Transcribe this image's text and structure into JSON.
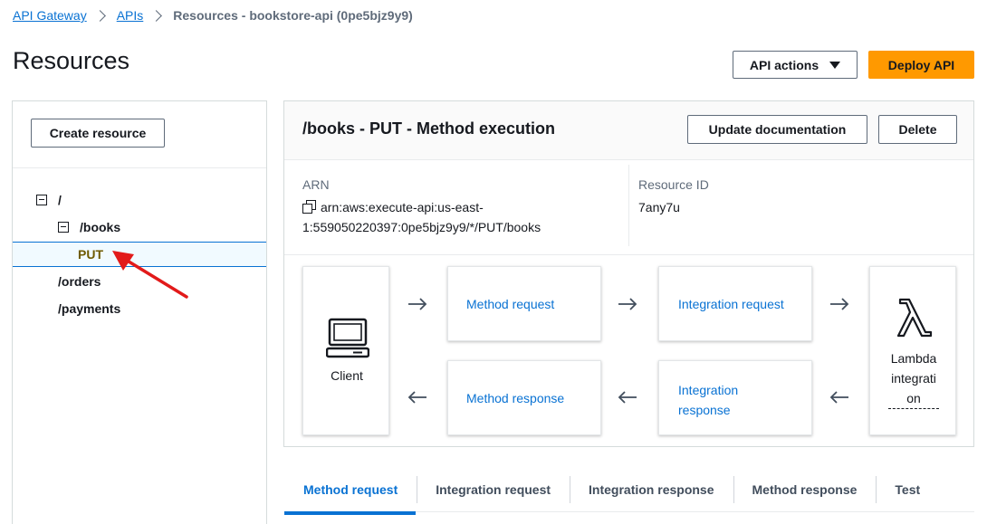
{
  "breadcrumb": {
    "items": [
      "API Gateway",
      "APIs"
    ],
    "current": "Resources - bookstore-api (0pe5bjz9y9)"
  },
  "page": {
    "title": "Resources",
    "api_actions_label": "API actions",
    "deploy_label": "Deploy API"
  },
  "left_panel": {
    "create_resource_label": "Create resource",
    "tree": [
      {
        "label": "/",
        "expanded": true
      },
      {
        "label": "/books",
        "expanded": true
      },
      {
        "label": "PUT",
        "selected": true
      },
      {
        "label": "/orders"
      },
      {
        "label": "/payments"
      }
    ]
  },
  "method_execution": {
    "title": "/books - PUT - Method execution",
    "update_doc_label": "Update documentation",
    "delete_label": "Delete",
    "arn_label": "ARN",
    "arn_value_line1": "arn:aws:execute-api:us-east-",
    "arn_value_line2": "1:559050220397:0pe5bjz9y9/*/PUT/books",
    "resource_id_label": "Resource ID",
    "resource_id_value": "7any7u",
    "flow": {
      "client_label": "Client",
      "method_request": "Method request",
      "integration_request": "Integration request",
      "method_response": "Method response",
      "integration_response_line1": "Integration",
      "integration_response_line2": "response",
      "lambda_line1": "Lambda",
      "lambda_line2": "integrati",
      "lambda_line3": "on"
    }
  },
  "tabs": [
    "Method request",
    "Integration request",
    "Integration response",
    "Method response",
    "Test"
  ],
  "colors": {
    "link": "#0972d3",
    "primary_button": "#ff9900",
    "annotation_arrow": "#e21a1a"
  }
}
